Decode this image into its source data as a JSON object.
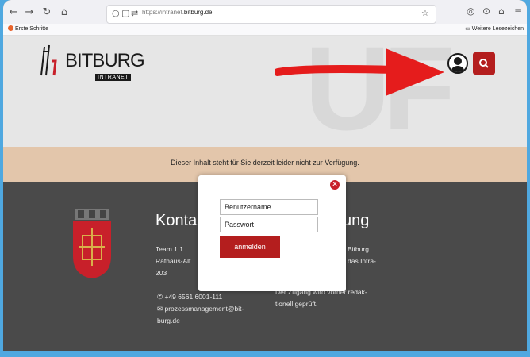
{
  "browser": {
    "url_prefix": "https://intranet.",
    "url_domain": "bitburg.de",
    "bookmarks_left": "Erste Schritte",
    "bookmarks_right": "Weitere Lesezeichen"
  },
  "site": {
    "logo_text": "BITBURG",
    "logo_sub": "INTRANET",
    "notice": "Dieser Inhalt steht für Sie derzeit leider nicht zur Verfügung."
  },
  "footer": {
    "heading_left": "Konta",
    "heading_right": "ung",
    "address_line1": "Team 1.1",
    "address_line2": "Rathaus-Alt",
    "address_line3": "203",
    "phone": "+49 6561 6001-111",
    "email_line1": "prozessmanagement@bit-",
    "email_line2": "burg.de",
    "right_text1": "Bitburg",
    "right_text2": "das Intra-",
    "right_text3": "Der Zugang wird vorher redak-",
    "right_text4": "tionell geprüft."
  },
  "login": {
    "username_placeholder": "Benutzername",
    "password_placeholder": "Passwort",
    "submit_label": "anmelden"
  },
  "colors": {
    "brand_red": "#b41e1e",
    "notice_bg": "#e3c6ab",
    "arrow_red": "#e51c1c"
  }
}
